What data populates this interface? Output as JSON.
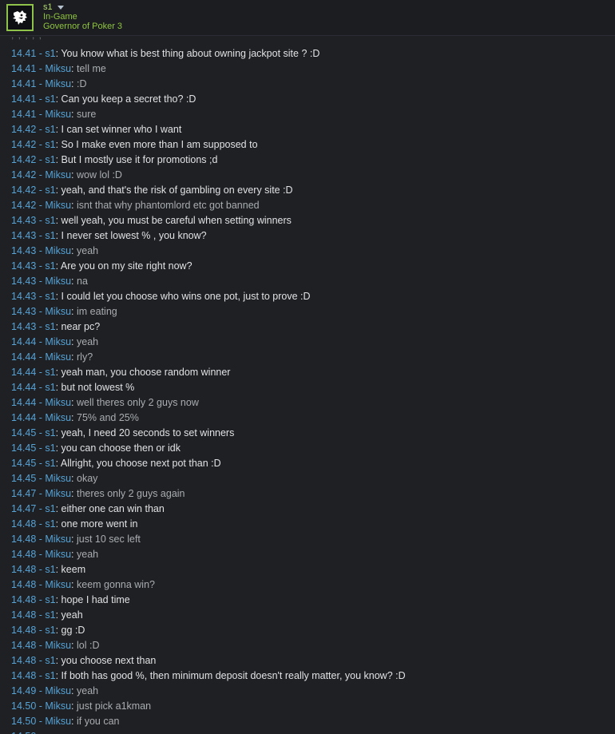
{
  "header": {
    "name": "s1",
    "status": "In-Game",
    "game": "Governor of Poker 3",
    "avatar_icon": "white-beast-head-icon",
    "accent_color": "#8ec24a"
  },
  "chat": {
    "cut_off_top_text": ", , ,   , , ",
    "messages": [
      {
        "time": "14.41",
        "sender": "s1",
        "text": "You know what is best thing about owning jackpot site ? :D"
      },
      {
        "time": "14.41",
        "sender": "Miksu",
        "text": "tell me"
      },
      {
        "time": "14.41",
        "sender": "Miksu",
        "text": ":D"
      },
      {
        "time": "14.41",
        "sender": "s1",
        "text": "Can you keep a secret tho? :D"
      },
      {
        "time": "14.41",
        "sender": "Miksu",
        "text": "sure"
      },
      {
        "time": "14.42",
        "sender": "s1",
        "text": "I can set winner who I want"
      },
      {
        "time": "14.42",
        "sender": "s1",
        "text": "So I make even more than I am supposed to"
      },
      {
        "time": "14.42",
        "sender": "s1",
        "text": "But I mostly use it for promotions ;d"
      },
      {
        "time": "14.42",
        "sender": "Miksu",
        "text": "wow lol :D"
      },
      {
        "time": "14.42",
        "sender": "s1",
        "text": "yeah, and that's the risk of gambling on every site :D"
      },
      {
        "time": "14.42",
        "sender": "Miksu",
        "text": "isnt that why phantomlord etc got banned"
      },
      {
        "time": "14.43",
        "sender": "s1",
        "text": "well yeah, you must be careful when setting winners"
      },
      {
        "time": "14.43",
        "sender": "s1",
        "text": "I never set lowest % , you know?"
      },
      {
        "time": "14.43",
        "sender": "Miksu",
        "text": "yeah"
      },
      {
        "time": "14.43",
        "sender": "s1",
        "text": "Are you on my site right now?"
      },
      {
        "time": "14.43",
        "sender": "Miksu",
        "text": "na"
      },
      {
        "time": "14.43",
        "sender": "s1",
        "text": "I could let you choose who wins one pot, just to prove :D"
      },
      {
        "time": "14.43",
        "sender": "Miksu",
        "text": "im eating"
      },
      {
        "time": "14.43",
        "sender": "s1",
        "text": "near pc?"
      },
      {
        "time": "14.44",
        "sender": "Miksu",
        "text": "yeah"
      },
      {
        "time": "14.44",
        "sender": "Miksu",
        "text": "rly?"
      },
      {
        "time": "14.44",
        "sender": "s1",
        "text": "yeah man, you choose random winner"
      },
      {
        "time": "14.44",
        "sender": "s1",
        "text": "but not lowest %"
      },
      {
        "time": "14.44",
        "sender": "Miksu",
        "text": "well theres only 2 guys now"
      },
      {
        "time": "14.44",
        "sender": "Miksu",
        "text": "75% and 25%"
      },
      {
        "time": "14.45",
        "sender": "s1",
        "text": "yeah, I need 20 seconds to set winners"
      },
      {
        "time": "14.45",
        "sender": "s1",
        "text": "you can choose then or idk"
      },
      {
        "time": "14.45",
        "sender": "s1",
        "text": "Allright, you choose next pot than :D"
      },
      {
        "time": "14.45",
        "sender": "Miksu",
        "text": "okay"
      },
      {
        "time": "14.47",
        "sender": "Miksu",
        "text": "theres only 2 guys again"
      },
      {
        "time": "14.47",
        "sender": "s1",
        "text": "either one can win than"
      },
      {
        "time": "14.48",
        "sender": "s1",
        "text": "one more went in"
      },
      {
        "time": "14.48",
        "sender": "Miksu",
        "text": "just 10 sec left"
      },
      {
        "time": "14.48",
        "sender": "Miksu",
        "text": "yeah"
      },
      {
        "time": "14.48",
        "sender": "s1",
        "text": "keem"
      },
      {
        "time": "14.48",
        "sender": "Miksu",
        "text": "keem gonna win?"
      },
      {
        "time": "14.48",
        "sender": "s1",
        "text": "hope I had time"
      },
      {
        "time": "14.48",
        "sender": "s1",
        "text": "yeah"
      },
      {
        "time": "14.48",
        "sender": "s1",
        "text": "gg :D"
      },
      {
        "time": "14.48",
        "sender": "Miksu",
        "text": "lol :D"
      },
      {
        "time": "14.48",
        "sender": "s1",
        "text": "you choose next than"
      },
      {
        "time": "14.48",
        "sender": "s1",
        "text": "If both has good %, then minimum deposit doesn't really matter, you know? :D"
      },
      {
        "time": "14.49",
        "sender": "Miksu",
        "text": "yeah"
      },
      {
        "time": "14.50",
        "sender": "Miksu",
        "text": "just pick a1kman"
      },
      {
        "time": "14.50",
        "sender": "Miksu",
        "text": "if you can"
      },
      {
        "time": "14.50",
        "sender": "",
        "text": ""
      }
    ]
  }
}
